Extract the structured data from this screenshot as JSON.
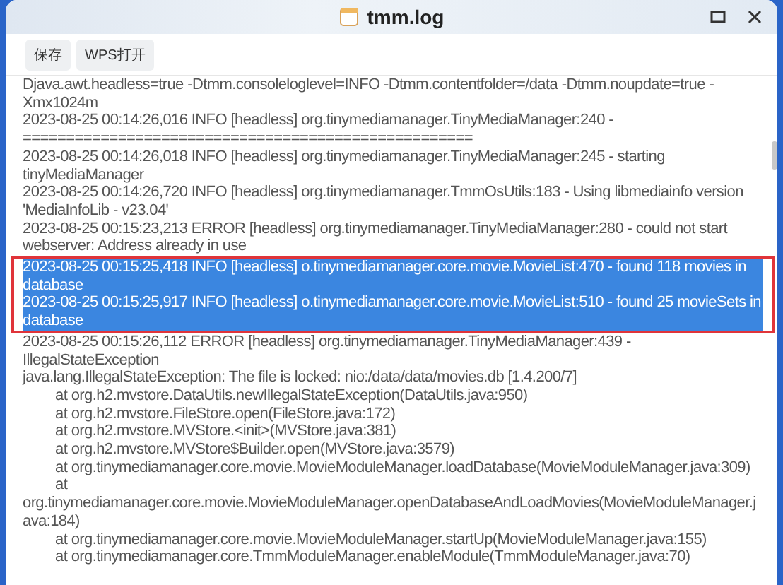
{
  "window": {
    "title": "tmm.log"
  },
  "toolbar": {
    "buttons": [
      "保存",
      "WPS打开"
    ]
  },
  "log": [
    {
      "kind": "line",
      "text": "Djava.awt.headless=true -Dtmm.consoleloglevel=INFO -Dtmm.contentfolder=/data -Dtmm.noupdate=true -Xmx1024m",
      "selected": false,
      "boxed": false
    },
    {
      "kind": "line",
      "text": "2023-08-25 00:14:26,016 INFO  [headless] org.tinymediamanager.TinyMediaManager:240 - ====================================================",
      "selected": false,
      "boxed": false
    },
    {
      "kind": "line",
      "text": "2023-08-25 00:14:26,018 INFO  [headless] org.tinymediamanager.TinyMediaManager:245 - starting tinyMediaManager",
      "selected": false,
      "boxed": false
    },
    {
      "kind": "line",
      "text": "2023-08-25 00:14:26,720 INFO  [headless] org.tinymediamanager.TmmOsUtils:183 - Using libmediainfo version 'MediaInfoLib - v23.04'",
      "selected": false,
      "boxed": false
    },
    {
      "kind": "line",
      "text": "2023-08-25 00:15:23,213 ERROR [headless] org.tinymediamanager.TinyMediaManager:280 - could not start webserver: Address already in use",
      "selected": false,
      "boxed": false
    },
    {
      "kind": "line",
      "text": "2023-08-25 00:15:25,418 INFO  [headless] o.tinymediamanager.core.movie.MovieList:470 - found 118 movies in database",
      "selected": true,
      "boxed": true
    },
    {
      "kind": "line",
      "text": "2023-08-25 00:15:25,917 INFO  [headless] o.tinymediamanager.core.movie.MovieList:510 - found 25 movieSets in database",
      "selected": true,
      "boxed": true
    },
    {
      "kind": "line",
      "text": "2023-08-25 00:15:26,112 ERROR [headless] org.tinymediamanager.TinyMediaManager:439 - IllegalStateException",
      "selected": false,
      "boxed": false
    },
    {
      "kind": "line",
      "text": "java.lang.IllegalStateException: The file is locked: nio:/data/data/movies.db [1.4.200/7]",
      "selected": false,
      "boxed": false
    },
    {
      "kind": "frame",
      "text": "at org.h2.mvstore.DataUtils.newIllegalStateException(DataUtils.java:950)",
      "selected": false,
      "boxed": false
    },
    {
      "kind": "frame",
      "text": "at org.h2.mvstore.FileStore.open(FileStore.java:172)",
      "selected": false,
      "boxed": false
    },
    {
      "kind": "frame",
      "text": "at org.h2.mvstore.MVStore.<init>(MVStore.java:381)",
      "selected": false,
      "boxed": false
    },
    {
      "kind": "frame",
      "text": "at org.h2.mvstore.MVStore$Builder.open(MVStore.java:3579)",
      "selected": false,
      "boxed": false
    },
    {
      "kind": "frame",
      "text": "at org.tinymediamanager.core.movie.MovieModuleManager.loadDatabase(MovieModuleManager.java:309)",
      "selected": false,
      "boxed": false
    },
    {
      "kind": "frame",
      "text": "at org.tinymediamanager.core.movie.MovieModuleManager.openDatabaseAndLoadMovies(MovieModuleManager.java:184)",
      "selected": false,
      "boxed": false
    },
    {
      "kind": "frame",
      "text": "at org.tinymediamanager.core.movie.MovieModuleManager.startUp(MovieModuleManager.java:155)",
      "selected": false,
      "boxed": false
    },
    {
      "kind": "frame",
      "text": "at org.tinymediamanager.core.TmmModuleManager.enableModule(TmmModuleManager.java:70)",
      "selected": false,
      "boxed": false
    }
  ]
}
